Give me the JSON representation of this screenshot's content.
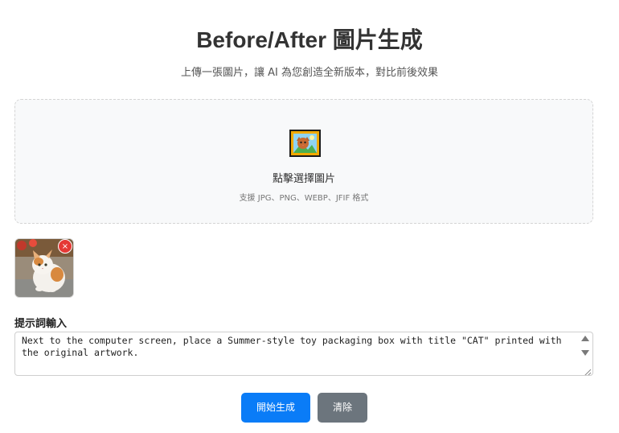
{
  "header": {
    "title": "Before/After 圖片生成",
    "subtitle": "上傳一張圖片，讓 AI 為您創造全新版本，對比前後效果"
  },
  "upload": {
    "label": "點擊選擇圖片",
    "hint": "支援 JPG、PNG、WEBP、JFIF 格式",
    "icon": "framed-picture-icon"
  },
  "preview": {
    "remove_label": "×"
  },
  "prompt": {
    "label": "提示詞輸入",
    "value": "Next to the computer screen, place a Summer-style toy packaging box with title \"CAT\" printed with the original artwork."
  },
  "actions": {
    "generate_label": "開始生成",
    "clear_label": "清除"
  },
  "colors": {
    "primary": "#0a7cf7",
    "secondary": "#6c757d",
    "remove": "#e53935"
  }
}
